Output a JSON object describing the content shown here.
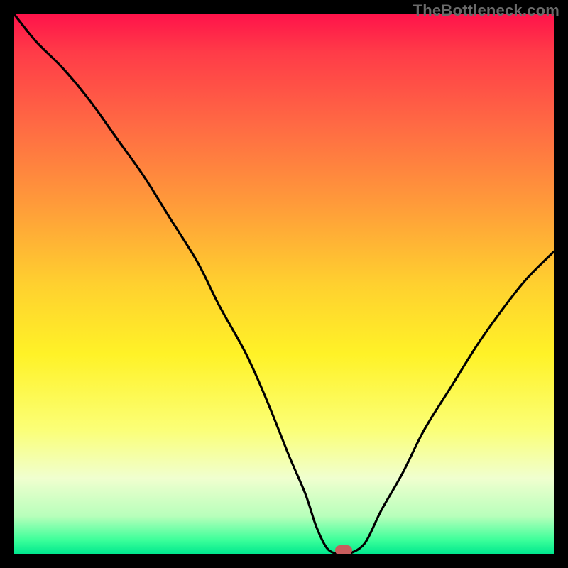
{
  "watermark": "TheBottleneck.com",
  "colors": {
    "page_bg": "#000000",
    "curve": "#000000",
    "marker": "#c95d5d",
    "watermark_text": "#6a6a6a"
  },
  "chart_data": {
    "type": "line",
    "title": "",
    "xlabel": "",
    "ylabel": "",
    "xlim": [
      0,
      100
    ],
    "ylim": [
      0,
      100
    ],
    "legend": false,
    "grid": false,
    "series": [
      {
        "name": "bottleneck-curve",
        "x": [
          0,
          4,
          9,
          14,
          19,
          24,
          29,
          34,
          38,
          43,
          47,
          51,
          54,
          56,
          58,
          60,
          62,
          65,
          68,
          72,
          76,
          81,
          86,
          91,
          95,
          100
        ],
        "values": [
          100,
          95,
          90,
          84,
          77,
          70,
          62,
          54,
          46,
          37,
          28,
          18,
          11,
          5,
          1,
          0,
          0,
          2,
          8,
          15,
          23,
          31,
          39,
          46,
          51,
          56
        ]
      }
    ],
    "marker": {
      "x": 61,
      "y": 0,
      "label": "optimal-point"
    },
    "gradient_stops": [
      {
        "pct": 0,
        "color": "#ff134a"
      },
      {
        "pct": 7,
        "color": "#ff3b48"
      },
      {
        "pct": 20,
        "color": "#ff6844"
      },
      {
        "pct": 35,
        "color": "#ff9a3a"
      },
      {
        "pct": 50,
        "color": "#ffd02f"
      },
      {
        "pct": 63,
        "color": "#fff227"
      },
      {
        "pct": 77,
        "color": "#fbff77"
      },
      {
        "pct": 86,
        "color": "#f0ffcf"
      },
      {
        "pct": 93,
        "color": "#b8ffbb"
      },
      {
        "pct": 97.5,
        "color": "#3bff9a"
      },
      {
        "pct": 100,
        "color": "#00e88e"
      }
    ]
  }
}
